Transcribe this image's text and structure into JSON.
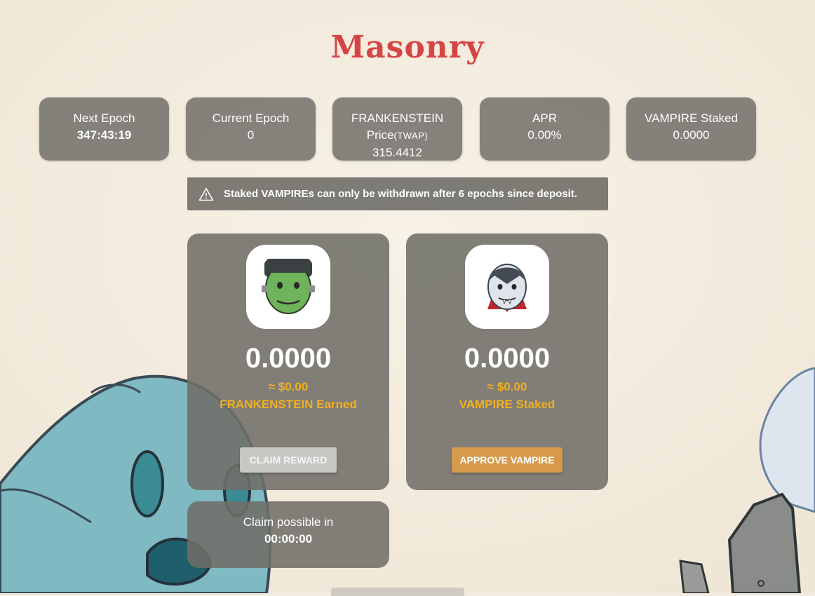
{
  "page": {
    "title": "Masonry"
  },
  "stats": [
    {
      "label": "Next Epoch",
      "value": "347:43:19"
    },
    {
      "label": "Current Epoch",
      "value": "0"
    },
    {
      "label": "FRANKENSTEIN",
      "label_line2": "Price",
      "label_suffix": "(TWAP)",
      "value": "315.4412"
    },
    {
      "label": "APR",
      "value": "0.00%"
    },
    {
      "label": "VAMPIRE Staked",
      "value": "0.0000"
    }
  ],
  "notice": {
    "text": "Staked VAMPIREs can only be withdrawn after 6 epochs since deposit.",
    "icon": "warning-icon"
  },
  "earn_card": {
    "amount": "0.0000",
    "usd": "≈ $0.00",
    "label": "FRANKENSTEIN Earned",
    "button": "Claim Reward",
    "icon": "frankenstein-token-icon"
  },
  "stake_card": {
    "amount": "0.0000",
    "usd": "≈ $0.00",
    "label": "VAMPIRE Staked",
    "button": "Approve VAMPIRE",
    "icon": "vampire-token-icon"
  },
  "claim_timer": {
    "label": "Claim possible in",
    "value": "00:00:00"
  },
  "colors": {
    "title": "#d64545",
    "accent": "#f0b022",
    "primary_button": "#d69a4a",
    "card": "#706e68"
  }
}
